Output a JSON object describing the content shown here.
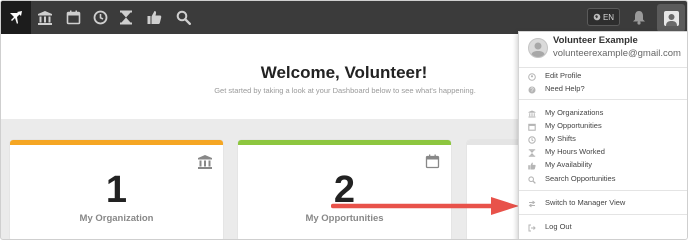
{
  "topbar": {
    "nav_icons": [
      "organizations-icon",
      "calendar-icon",
      "clock-icon",
      "hourglass-icon",
      "thumbs-up-icon",
      "search-icon"
    ],
    "language": "EN"
  },
  "welcome": {
    "title": "Welcome, Volunteer!",
    "subtitle": "Get started by taking a look at your Dashboard below to see what's happening."
  },
  "cards": [
    {
      "number": "1",
      "label": "My Organization",
      "color": "#f5a623",
      "icon": "organizations-icon"
    },
    {
      "number": "2",
      "label": "My Opportunities",
      "color": "#8dc63f",
      "icon": "calendar-icon"
    }
  ],
  "user_menu": {
    "name": "Volunteer Example",
    "email": "volunteerexample@gmail.com",
    "items": [
      {
        "label": "Edit Profile",
        "icon": "user-icon"
      },
      {
        "label": "Need Help?",
        "icon": "help-icon"
      },
      {
        "label": "My Organizations",
        "icon": "organizations-icon"
      },
      {
        "label": "My Opportunities",
        "icon": "calendar-icon"
      },
      {
        "label": "My Shifts",
        "icon": "clock-icon"
      },
      {
        "label": "My Hours Worked",
        "icon": "hourglass-icon"
      },
      {
        "label": "My Availability",
        "icon": "thumbs-up-icon"
      },
      {
        "label": "Search Opportunities",
        "icon": "search-icon"
      },
      {
        "label": "Switch to Manager View",
        "icon": "switch-icon"
      },
      {
        "label": "Log Out",
        "icon": "logout-icon"
      }
    ]
  },
  "annotation": {
    "arrow_color": "#e8524a"
  }
}
